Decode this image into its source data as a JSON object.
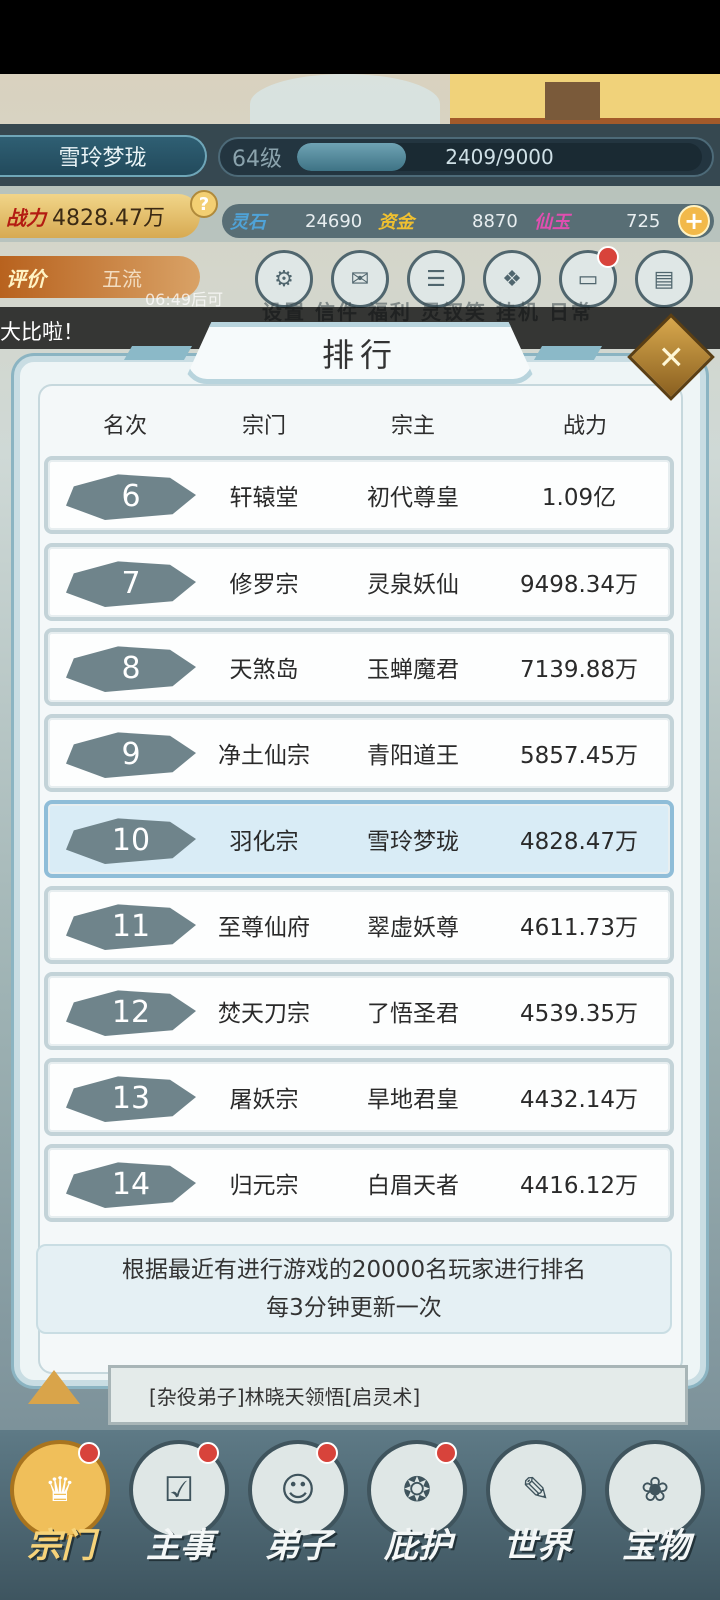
{
  "hud": {
    "player_name": "雪玲梦珑",
    "level": "64级",
    "xp": "2409/9000",
    "xp_fraction": 0.268,
    "power_label": "战力",
    "power_value": "4828.47万",
    "resources": [
      {
        "label": "灵石",
        "value": "24690",
        "color": "#4fa3d8"
      },
      {
        "label": "资金",
        "value": "8870",
        "color": "#f0c030"
      },
      {
        "label": "仙玉",
        "value": "725",
        "color": "#e04fb0"
      }
    ],
    "rating_label": "评价",
    "rating_value": "五流",
    "timer": "06:49后可",
    "menu_labels": "设置 信件 福利 灵钗笑 挂机 日常",
    "marquee": "大比啦！"
  },
  "ranking": {
    "title": "排行",
    "headers": [
      "名次",
      "宗门",
      "宗主",
      "战力"
    ],
    "rows": [
      {
        "rank": "6",
        "sect": "轩辕堂",
        "leader": "初代尊皇",
        "power": "1.09亿"
      },
      {
        "rank": "7",
        "sect": "修罗宗",
        "leader": "灵泉妖仙",
        "power": "9498.34万"
      },
      {
        "rank": "8",
        "sect": "天煞岛",
        "leader": "玉蝉魔君",
        "power": "7139.88万"
      },
      {
        "rank": "9",
        "sect": "净土仙宗",
        "leader": "青阳道王",
        "power": "5857.45万"
      },
      {
        "rank": "10",
        "sect": "羽化宗",
        "leader": "雪玲梦珑",
        "power": "4828.47万"
      },
      {
        "rank": "11",
        "sect": "至尊仙府",
        "leader": "翠虚妖尊",
        "power": "4611.73万"
      },
      {
        "rank": "12",
        "sect": "焚天刀宗",
        "leader": "了悟圣君",
        "power": "4539.35万"
      },
      {
        "rank": "13",
        "sect": "屠妖宗",
        "leader": "旱地君皇",
        "power": "4432.14万"
      },
      {
        "rank": "14",
        "sect": "归元宗",
        "leader": "白眉天者",
        "power": "4416.12万"
      }
    ],
    "note_line1": "根据最近有进行游戏的20000名玩家进行排名",
    "note_line2": "每3分钟更新一次"
  },
  "log": "[杂役弟子]林晓天领悟[启灵术]",
  "nav": [
    {
      "label": "宗门",
      "icon": "sect-icon",
      "active": true
    },
    {
      "label": "主事",
      "icon": "task-icon",
      "active": false
    },
    {
      "label": "弟子",
      "icon": "disciple-icon",
      "active": false
    },
    {
      "label": "庇护",
      "icon": "shelter-icon",
      "active": false
    },
    {
      "label": "世界",
      "icon": "world-icon",
      "active": false
    },
    {
      "label": "宝物",
      "icon": "treasure-icon",
      "active": false
    }
  ]
}
